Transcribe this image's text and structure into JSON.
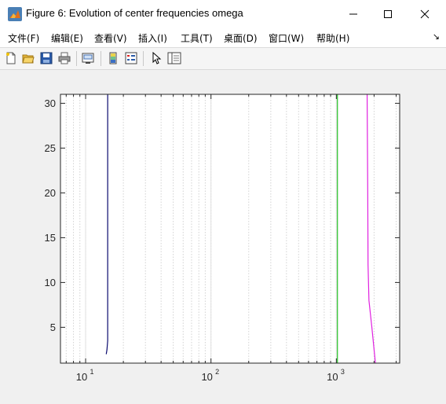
{
  "window": {
    "title": "Figure 6: Evolution of center frequencies omega",
    "minimize_icon": "minimize-icon",
    "maximize_icon": "maximize-icon",
    "close_icon": "close-icon"
  },
  "menu": {
    "items": [
      "文件(F)",
      "编辑(E)",
      "查看(V)",
      "插入(I)",
      "工具(T)",
      "桌面(D)",
      "窗口(W)",
      "帮助(H)"
    ]
  },
  "toolbar": {
    "icons": [
      "new-figure-icon",
      "open-file-icon",
      "save-icon",
      "print-icon",
      "link-plot-icon",
      "colorbar-icon",
      "legend-icon",
      "pointer-icon",
      "property-inspector-icon"
    ]
  },
  "chart_data": {
    "type": "line",
    "title": "",
    "xlabel": "",
    "ylabel": "",
    "xscale": "log",
    "xlim": [
      6.3,
      3200
    ],
    "ylim": [
      1,
      31
    ],
    "xticks": [
      10,
      100,
      1000
    ],
    "xtick_labels": [
      {
        "base": "10",
        "exp": "1"
      },
      {
        "base": "10",
        "exp": "2"
      },
      {
        "base": "10",
        "exp": "3"
      }
    ],
    "yticks": [
      5,
      10,
      15,
      20,
      25,
      30
    ],
    "ytick_labels": [
      "5",
      "10",
      "15",
      "20",
      "25",
      "30"
    ],
    "grid": "x-minor-dotted",
    "series": [
      {
        "color": "#0a0a6e",
        "points": [
          [
            14.6,
            2
          ],
          [
            14.8,
            2.5
          ],
          [
            15.0,
            3.5
          ],
          [
            15.0,
            31
          ]
        ]
      },
      {
        "color": "#22c022",
        "points": [
          [
            1020,
            1
          ],
          [
            1020,
            31
          ]
        ]
      },
      {
        "color": "#e020e0",
        "points": [
          [
            2050,
            1
          ],
          [
            1920,
            5
          ],
          [
            1820,
            8
          ],
          [
            1790,
            12
          ],
          [
            1780,
            20
          ],
          [
            1760,
            31
          ]
        ]
      }
    ]
  }
}
